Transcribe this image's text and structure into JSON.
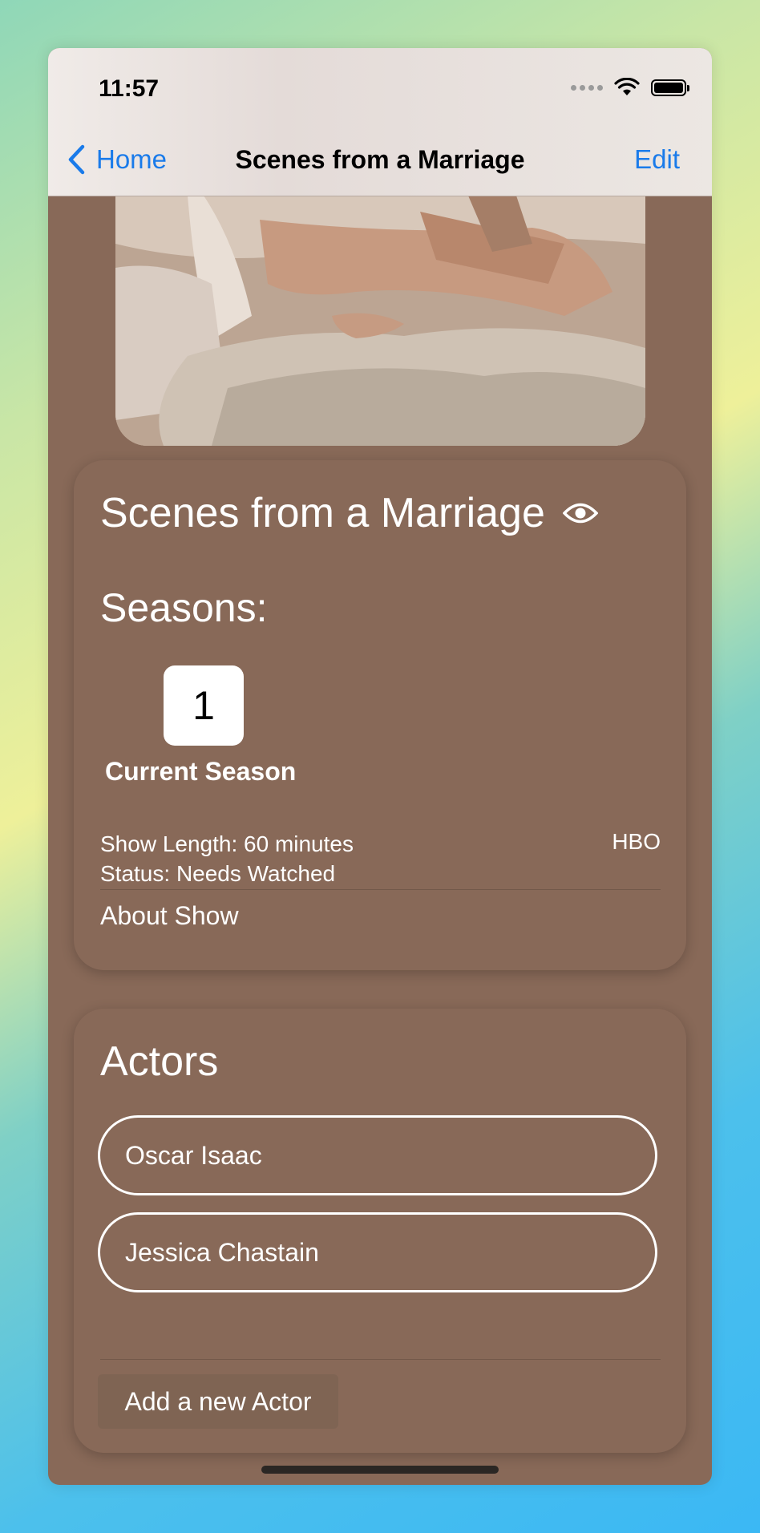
{
  "status_bar": {
    "time": "11:57"
  },
  "nav": {
    "back_label": "Home",
    "title": "Scenes from a Marriage",
    "edit_label": "Edit"
  },
  "show": {
    "title": "Scenes from a Marriage",
    "watch_icon": "eye-icon",
    "seasons_label": "Seasons:",
    "seasons": [
      "1"
    ],
    "season_caption": "Current Season",
    "length": "Show Length: 60 minutes",
    "status": "Status: Needs Watched",
    "network": "HBO",
    "about_label": "About Show"
  },
  "actors": {
    "title": "Actors",
    "items": [
      {
        "name": "Oscar Isaac"
      },
      {
        "name": "Jessica Chastain"
      }
    ],
    "add_label": "Add a new Actor"
  },
  "colors": {
    "background": "#886958",
    "accent": "#1a7bea",
    "text": "#ffffff"
  }
}
